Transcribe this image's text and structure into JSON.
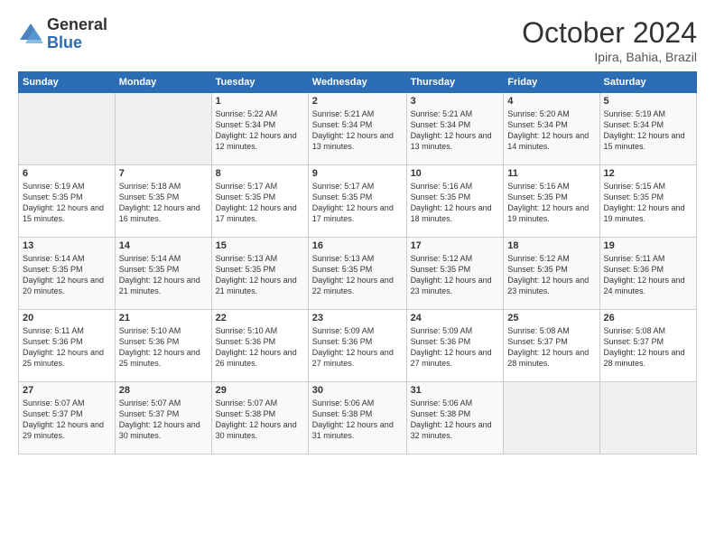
{
  "logo": {
    "general": "General",
    "blue": "Blue"
  },
  "title": "October 2024",
  "location": "Ipira, Bahia, Brazil",
  "days_of_week": [
    "Sunday",
    "Monday",
    "Tuesday",
    "Wednesday",
    "Thursday",
    "Friday",
    "Saturday"
  ],
  "weeks": [
    [
      {
        "num": "",
        "detail": ""
      },
      {
        "num": "",
        "detail": ""
      },
      {
        "num": "1",
        "detail": "Sunrise: 5:22 AM\nSunset: 5:34 PM\nDaylight: 12 hours and 12 minutes."
      },
      {
        "num": "2",
        "detail": "Sunrise: 5:21 AM\nSunset: 5:34 PM\nDaylight: 12 hours and 13 minutes."
      },
      {
        "num": "3",
        "detail": "Sunrise: 5:21 AM\nSunset: 5:34 PM\nDaylight: 12 hours and 13 minutes."
      },
      {
        "num": "4",
        "detail": "Sunrise: 5:20 AM\nSunset: 5:34 PM\nDaylight: 12 hours and 14 minutes."
      },
      {
        "num": "5",
        "detail": "Sunrise: 5:19 AM\nSunset: 5:34 PM\nDaylight: 12 hours and 15 minutes."
      }
    ],
    [
      {
        "num": "6",
        "detail": "Sunrise: 5:19 AM\nSunset: 5:35 PM\nDaylight: 12 hours and 15 minutes."
      },
      {
        "num": "7",
        "detail": "Sunrise: 5:18 AM\nSunset: 5:35 PM\nDaylight: 12 hours and 16 minutes."
      },
      {
        "num": "8",
        "detail": "Sunrise: 5:17 AM\nSunset: 5:35 PM\nDaylight: 12 hours and 17 minutes."
      },
      {
        "num": "9",
        "detail": "Sunrise: 5:17 AM\nSunset: 5:35 PM\nDaylight: 12 hours and 17 minutes."
      },
      {
        "num": "10",
        "detail": "Sunrise: 5:16 AM\nSunset: 5:35 PM\nDaylight: 12 hours and 18 minutes."
      },
      {
        "num": "11",
        "detail": "Sunrise: 5:16 AM\nSunset: 5:35 PM\nDaylight: 12 hours and 19 minutes."
      },
      {
        "num": "12",
        "detail": "Sunrise: 5:15 AM\nSunset: 5:35 PM\nDaylight: 12 hours and 19 minutes."
      }
    ],
    [
      {
        "num": "13",
        "detail": "Sunrise: 5:14 AM\nSunset: 5:35 PM\nDaylight: 12 hours and 20 minutes."
      },
      {
        "num": "14",
        "detail": "Sunrise: 5:14 AM\nSunset: 5:35 PM\nDaylight: 12 hours and 21 minutes."
      },
      {
        "num": "15",
        "detail": "Sunrise: 5:13 AM\nSunset: 5:35 PM\nDaylight: 12 hours and 21 minutes."
      },
      {
        "num": "16",
        "detail": "Sunrise: 5:13 AM\nSunset: 5:35 PM\nDaylight: 12 hours and 22 minutes."
      },
      {
        "num": "17",
        "detail": "Sunrise: 5:12 AM\nSunset: 5:35 PM\nDaylight: 12 hours and 23 minutes."
      },
      {
        "num": "18",
        "detail": "Sunrise: 5:12 AM\nSunset: 5:35 PM\nDaylight: 12 hours and 23 minutes."
      },
      {
        "num": "19",
        "detail": "Sunrise: 5:11 AM\nSunset: 5:36 PM\nDaylight: 12 hours and 24 minutes."
      }
    ],
    [
      {
        "num": "20",
        "detail": "Sunrise: 5:11 AM\nSunset: 5:36 PM\nDaylight: 12 hours and 25 minutes."
      },
      {
        "num": "21",
        "detail": "Sunrise: 5:10 AM\nSunset: 5:36 PM\nDaylight: 12 hours and 25 minutes."
      },
      {
        "num": "22",
        "detail": "Sunrise: 5:10 AM\nSunset: 5:36 PM\nDaylight: 12 hours and 26 minutes."
      },
      {
        "num": "23",
        "detail": "Sunrise: 5:09 AM\nSunset: 5:36 PM\nDaylight: 12 hours and 27 minutes."
      },
      {
        "num": "24",
        "detail": "Sunrise: 5:09 AM\nSunset: 5:36 PM\nDaylight: 12 hours and 27 minutes."
      },
      {
        "num": "25",
        "detail": "Sunrise: 5:08 AM\nSunset: 5:37 PM\nDaylight: 12 hours and 28 minutes."
      },
      {
        "num": "26",
        "detail": "Sunrise: 5:08 AM\nSunset: 5:37 PM\nDaylight: 12 hours and 28 minutes."
      }
    ],
    [
      {
        "num": "27",
        "detail": "Sunrise: 5:07 AM\nSunset: 5:37 PM\nDaylight: 12 hours and 29 minutes."
      },
      {
        "num": "28",
        "detail": "Sunrise: 5:07 AM\nSunset: 5:37 PM\nDaylight: 12 hours and 30 minutes."
      },
      {
        "num": "29",
        "detail": "Sunrise: 5:07 AM\nSunset: 5:38 PM\nDaylight: 12 hours and 30 minutes."
      },
      {
        "num": "30",
        "detail": "Sunrise: 5:06 AM\nSunset: 5:38 PM\nDaylight: 12 hours and 31 minutes."
      },
      {
        "num": "31",
        "detail": "Sunrise: 5:06 AM\nSunset: 5:38 PM\nDaylight: 12 hours and 32 minutes."
      },
      {
        "num": "",
        "detail": ""
      },
      {
        "num": "",
        "detail": ""
      }
    ]
  ]
}
